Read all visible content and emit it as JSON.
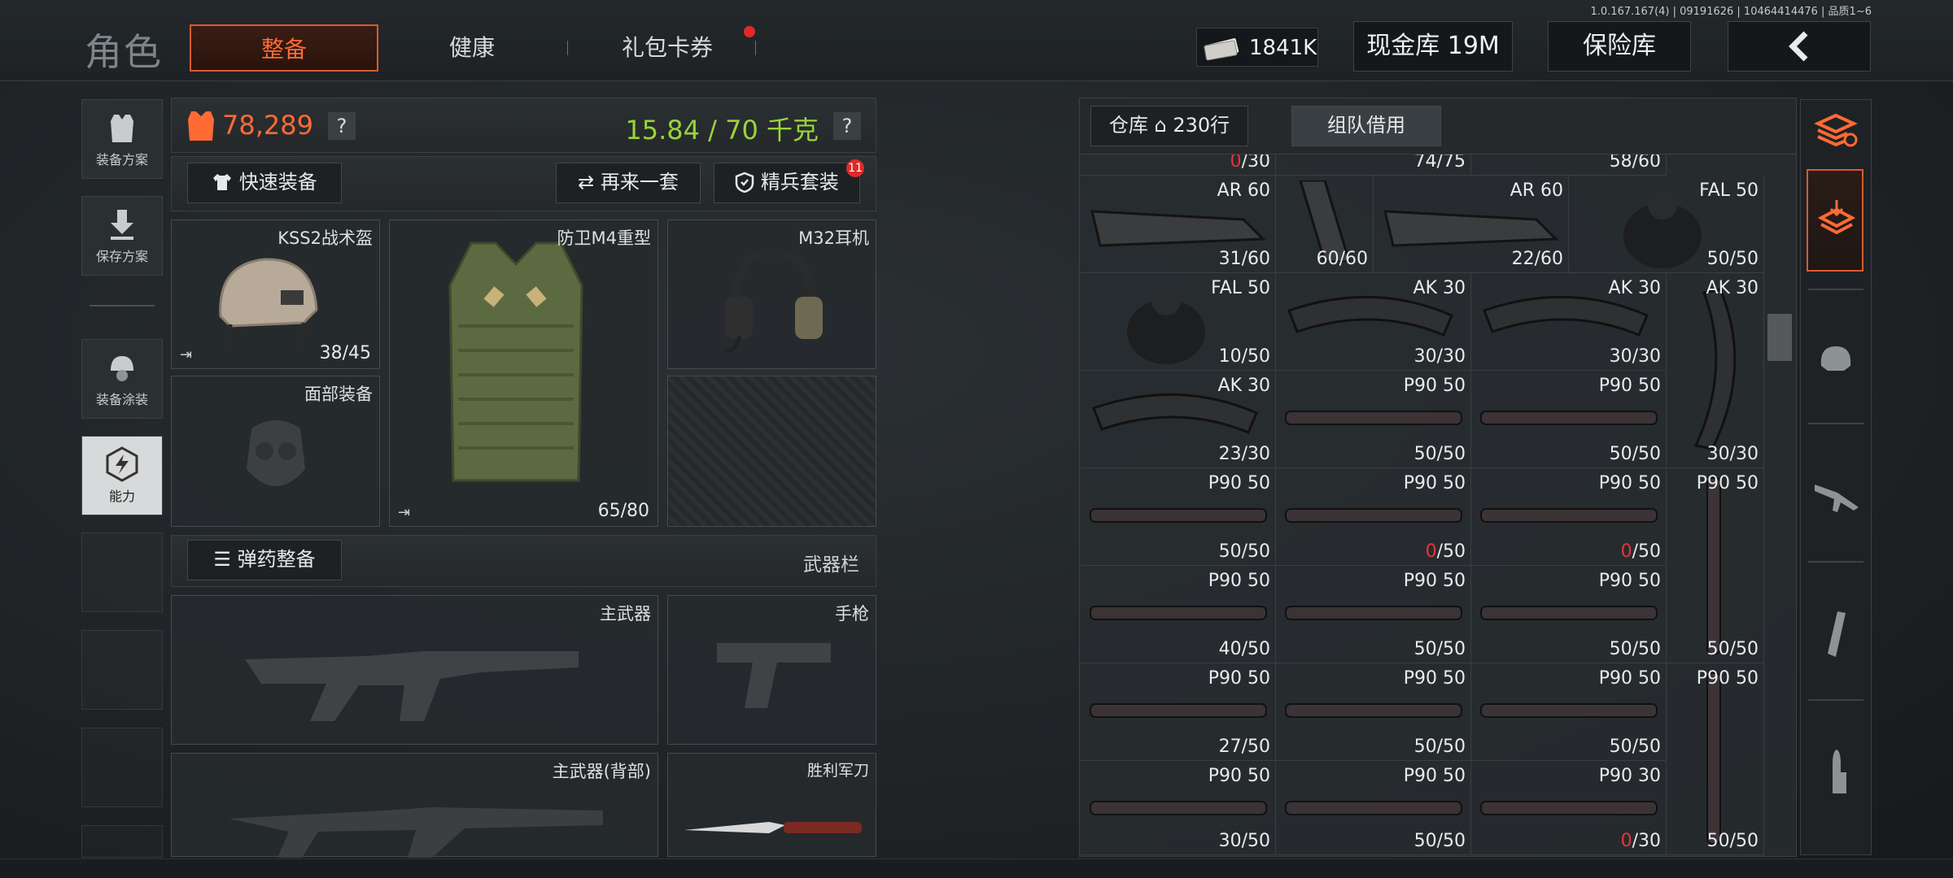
{
  "version": "1.0.167.167(4) | 09191626 | 10464414476 | 品质1~6",
  "header": {
    "title": "角色",
    "tabs": [
      {
        "label": "整备",
        "active": true
      },
      {
        "label": "健康",
        "active": false
      },
      {
        "label": "礼包卡券",
        "active": false,
        "badge": true
      }
    ],
    "money": "1841K",
    "cash_vault": "现金库 19M",
    "insurance": "保险库",
    "back_icon": "chevron-left-icon"
  },
  "left_rail": [
    {
      "label": "装备方案",
      "icon": "vest-icon"
    },
    {
      "label": "保存方案",
      "icon": "download-icon"
    },
    {
      "label": "装备涂装",
      "icon": "helmet-paint-icon"
    },
    {
      "label": "能力",
      "icon": "ability-icon",
      "active": true
    }
  ],
  "loadout": {
    "value": "78,289",
    "weight": "15.84 / 70 千克",
    "help": "?",
    "quick_equip": "快速装备",
    "again": "再来一套",
    "elite_set": "精兵套装",
    "elite_badge": "11",
    "slots": {
      "helmet": {
        "name": "KSS2战术盔",
        "durability": "38/45"
      },
      "armor": {
        "name": "防卫M4重型",
        "durability": "65/80"
      },
      "headset": {
        "name": "M32耳机"
      },
      "face": {
        "name": "面部装备"
      }
    },
    "ammo_equip": "弹药整备",
    "weapon_bar": "武器栏",
    "weapons": {
      "primary": "主武器",
      "pistol": "手枪",
      "primary_back": "主武器(背部)",
      "knife": "胜利军刀"
    }
  },
  "warehouse": {
    "tab_warehouse": "仓库",
    "rows": "230行",
    "tab_team": "组队借用",
    "top_partial": [
      {
        "count_red": "0",
        "count_rest": "/30"
      },
      {
        "count": "74/75"
      },
      {
        "count": "58/60"
      }
    ],
    "cells": [
      {
        "name": "AR 60",
        "count": "31/60"
      },
      {
        "name": "",
        "count": "60/60"
      },
      {
        "name": "AR 60",
        "count": "22/60"
      },
      {
        "name": "FAL 50",
        "count": "50/50"
      },
      {
        "name": "FAL 50",
        "count": "10/50"
      },
      {
        "name": "AK 30",
        "count": "30/30"
      },
      {
        "name": "AK 30",
        "count": "30/30"
      },
      {
        "name": "AK 30",
        "count": ""
      },
      {
        "name": "AK 30",
        "count": "23/30"
      },
      {
        "name": "P90 50",
        "count": "50/50"
      },
      {
        "name": "P90 50",
        "count": "50/50"
      },
      {
        "name": "",
        "count": "30/30"
      },
      {
        "name": "P90 50",
        "count": "50/50"
      },
      {
        "name": "P90 50",
        "count_red": "0",
        "count_rest": "/50"
      },
      {
        "name": "P90 50",
        "count_red": "0",
        "count_rest": "/50"
      },
      {
        "name": "P90 50",
        "count": ""
      },
      {
        "name": "P90 50",
        "count": "40/50"
      },
      {
        "name": "P90 50",
        "count": "50/50"
      },
      {
        "name": "P90 50",
        "count": "50/50"
      },
      {
        "name": "",
        "count": "50/50"
      },
      {
        "name": "P90 50",
        "count": "27/50"
      },
      {
        "name": "P90 50",
        "count": "50/50"
      },
      {
        "name": "P90 50",
        "count": "50/50"
      },
      {
        "name": "P90 50",
        "count": ""
      },
      {
        "name": "P90 50",
        "count": "30/50"
      },
      {
        "name": "P90 50",
        "count": "50/50"
      },
      {
        "name": "P90 30",
        "count_red": "0",
        "count_rest": "/30"
      },
      {
        "name": "",
        "count": "50/50"
      }
    ]
  },
  "right_rail": [
    "stack-refresh-icon",
    "stack-arrow-icon",
    "helmet-icon",
    "rifle-icon",
    "magazine-icon",
    "bullet-icon"
  ],
  "colors": {
    "accent": "#ff6a35",
    "weight_green": "#9ad43a",
    "red": "#e5343c"
  }
}
